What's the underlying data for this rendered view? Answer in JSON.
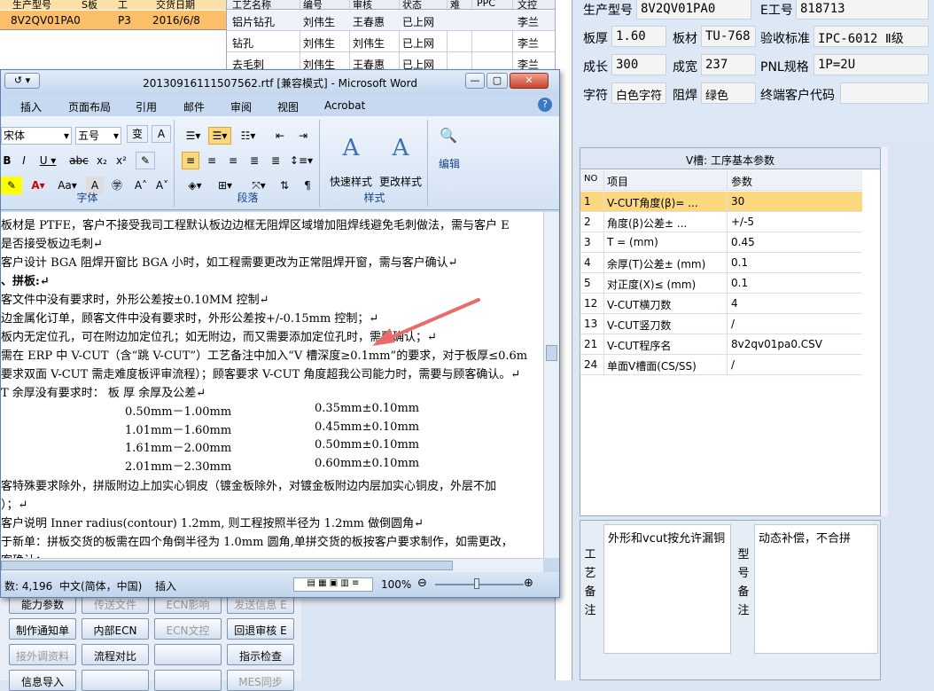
{
  "top_left_grid": {
    "headers": [
      "生产型号",
      "S板",
      "工",
      "交货日期"
    ],
    "row": {
      "model": "8V2QV01PA0",
      "col2": "P3",
      "date": "2016/6/8"
    }
  },
  "mid_grid": {
    "headers": [
      "工艺名称",
      "编号",
      "审核",
      "状态",
      "难",
      "PPC",
      "文控"
    ],
    "rows": [
      [
        "铝片钻孔",
        "刘伟生",
        "王春惠",
        "已上网",
        "",
        "",
        "李兰"
      ],
      [
        "钻孔",
        "刘伟生",
        "刘伟生",
        "已上网",
        "",
        "",
        "李兰"
      ],
      [
        "去毛刺",
        "刘伟生",
        "王春惠",
        "已上网",
        "",
        "",
        "李兰"
      ]
    ]
  },
  "info": {
    "prod_model_label": "生产型号",
    "prod_model": "8V2QV01PA0",
    "eng_label": "E工号",
    "eng": "818713",
    "thick_label": "板厚",
    "thick": "1.60",
    "mat_label": "板材",
    "mat": "TU-768",
    "std_label": "验收标准",
    "std": "IPC-6012 Ⅱ级",
    "len_label": "成长",
    "len": "300",
    "wid_label": "成宽",
    "wid": "237",
    "pnl_label": "PNL规格",
    "pnl": "1P=2U",
    "char_label": "字符",
    "char": "白色字符",
    "mask_label": "阻焊",
    "mask": "绿色",
    "end_label": "终端客户代码",
    "end": ""
  },
  "vcut": {
    "title": "V槽: 工序基本参数",
    "head": {
      "no": "NO",
      "item": "项目",
      "param": "参数"
    },
    "rows": [
      {
        "no": "1",
        "item": "V-CUT角度(β)=  ...",
        "param": "30"
      },
      {
        "no": "2",
        "item": "角度(β)公差±  ...",
        "param": "+/-5"
      },
      {
        "no": "3",
        "item": "T =  (mm)",
        "param": "0.45"
      },
      {
        "no": "4",
        "item": "余厚(T)公差±  (mm)",
        "param": "0.1"
      },
      {
        "no": "5",
        "item": "对正度(X)≤ (mm)",
        "param": "0.1"
      },
      {
        "no": "12",
        "item": "V-CUT横刀数",
        "param": "4"
      },
      {
        "no": "13",
        "item": "V-CUT竖刀数",
        "param": "/"
      },
      {
        "no": "21",
        "item": "V-CUT程序名",
        "param": "8v2qv01pa0.CSV"
      },
      {
        "no": "24",
        "item": "单面V槽面(CS/SS)",
        "param": "/"
      }
    ]
  },
  "notes": {
    "craft_label": [
      "工",
      "艺",
      "备",
      "注"
    ],
    "craft_text": "外形和vcut按允许漏铜",
    "model_label": [
      "型",
      "号",
      "备",
      "注"
    ],
    "model_text": "动态补偿，不合拼"
  },
  "buttons": [
    {
      "label": "能力参数",
      "dim": false
    },
    {
      "label": "传送文件",
      "dim": true
    },
    {
      "label": "ECN影响",
      "dim": true
    },
    {
      "label": "发送信息 E",
      "dim": true
    },
    {
      "label": "制作通知单",
      "dim": false
    },
    {
      "label": "内部ECN",
      "dim": false
    },
    {
      "label": "ECN文控",
      "dim": true
    },
    {
      "label": "回退审核 E",
      "dim": false
    },
    {
      "label": "接外调资料",
      "dim": true
    },
    {
      "label": "流程对比",
      "dim": false
    },
    {
      "label": "",
      "dim": false
    },
    {
      "label": "指示检查",
      "dim": false
    },
    {
      "label": "信息导入",
      "dim": false
    },
    {
      "label": "",
      "dim": false
    },
    {
      "label": "",
      "dim": false
    },
    {
      "label": "MES同步",
      "dim": true
    }
  ],
  "word": {
    "title": "20130916111507562.rtf [兼容模式] - Microsoft Word",
    "tabs": [
      "插入",
      "页面布局",
      "引用",
      "邮件",
      "审阅",
      "视图",
      "Acrobat"
    ],
    "font_name": "宋体",
    "font_size": "五号",
    "group_font": "字体",
    "group_para": "段落",
    "group_style": "样式",
    "quick_style": "快速样式",
    "change_style": "更改样式",
    "edit": "编辑",
    "doc_lines": [
      "板材是 PTFE，客户不接受我司工程默认板边边框无阻焊区域增加阻焊线避免毛刺做法，需与客户 E",
      "是否接受板边毛刺↵",
      "客户设计 BGA 阻焊开窗比 BGA 小时，如工程需要更改为正常阻焊开窗，需与客户确认↵",
      "、拼板:↵",
      "客文件中没有要求时，外形公差按±0.10MM 控制↵",
      "边金属化订单，顾客文件中没有要求时，外形公差按+/-0.15mm 控制；↵",
      "板内无定位孔，可在附边加定位孔；如无附边，而又需要添加定位孔时，需要确认；↵",
      "需在 ERP 中 V-CUT（含“跳 V-CUT”）工艺备注中加入“V 槽深度≥0.1mm”的要求，对于板厚≤0.6m",
      "要求双面 V-CUT 需走难度板评审流程）；顾客要求 V-CUT 角度超我公司能力时，需要与顾客确认。↵",
      "T 余厚没有要求时：        板    厚                              余厚及公差↵"
    ],
    "thick_table": [
      [
        "0.50mm－1.00mm",
        "0.35mm±0.10mm"
      ],
      [
        "1.01mm－1.60mm",
        "0.45mm±0.10mm"
      ],
      [
        "1.61mm－2.00mm",
        "0.50mm±0.10mm"
      ],
      [
        "2.01mm－2.30mm",
        "0.60mm±0.10mm"
      ]
    ],
    "doc_lines2": [
      "客特殊要求除外，拼版附边上加实心铜皮（镀金板除外，对镀金板附边内层加实心铜皮，外层不加",
      "）；↵",
      "客户说明 Inner radius(contour) 1.2mm, 则工程按照半径为 1.2mm 做倒圆角↵",
      "于新单：拼板交货的板需在四个角倒半径为 1.0mm 圆角,单拼交货的板按客户要求制作，如需更改，",
      "客确认；"
    ],
    "status_words": "数: 4,196",
    "status_lang": "中文(简体，中国)",
    "status_insert": "插入",
    "zoom": "100%"
  }
}
